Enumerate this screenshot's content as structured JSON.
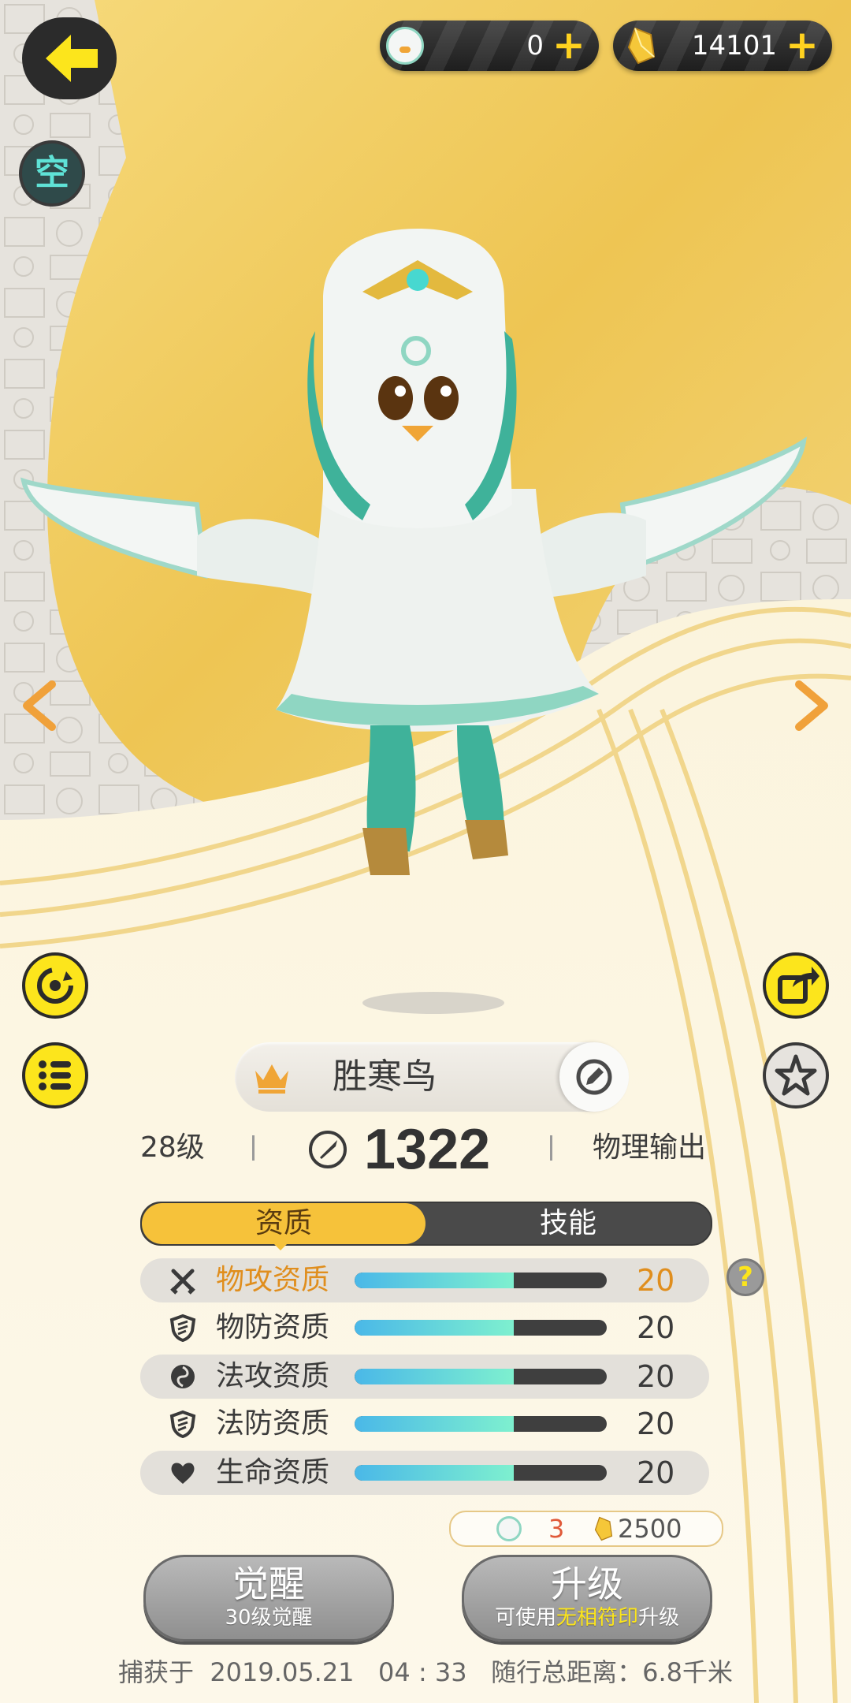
{
  "currency": {
    "pet_tokens": "0",
    "crystals": "14101",
    "add_symbol": "+"
  },
  "element_badge": "空",
  "pet": {
    "name": "胜寒鸟",
    "level": "28级",
    "power": "1322",
    "role": "物理输出"
  },
  "tabs": [
    "资质",
    "技能"
  ],
  "attributes": [
    {
      "label": "物攻资质",
      "value": "20",
      "fill_fraction": 0.63,
      "icon": "swords-icon",
      "highlight": true
    },
    {
      "label": "物防资质",
      "value": "20",
      "fill_fraction": 0.63,
      "icon": "shield-icon",
      "highlight": false
    },
    {
      "label": "法攻资质",
      "value": "20",
      "fill_fraction": 0.63,
      "icon": "magic-orb-icon",
      "highlight": false
    },
    {
      "label": "法防资质",
      "value": "20",
      "fill_fraction": 0.63,
      "icon": "shield-icon",
      "highlight": false
    },
    {
      "label": "生命资质",
      "value": "20",
      "fill_fraction": 0.63,
      "icon": "heart-icon",
      "highlight": false
    }
  ],
  "help_symbol": "?",
  "upgrade_cost": {
    "tokens": "3",
    "crystals": "2500"
  },
  "buttons": {
    "awaken_label": "觉醒",
    "awaken_sub": "30级觉醒",
    "upgrade_label": "升级",
    "upgrade_sub_prefix": "可使用",
    "upgrade_sub_item": "无相符印",
    "upgrade_sub_suffix": "升级"
  },
  "footer": "捕获于  2019.05.21   04 : 33   随行总距离：6.8千米",
  "colors": {
    "accent_yellow": "#fce51c",
    "highlight_orange": "#e08e1d",
    "bar_start": "#4ab8e8",
    "bar_end": "#7ef0cf"
  }
}
